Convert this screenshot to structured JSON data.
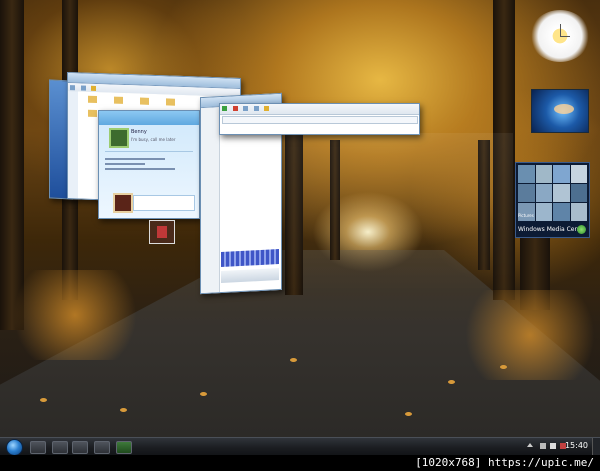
{
  "taskbar": {
    "clock": "15:40"
  },
  "gadgets": {
    "media_center_label": "Windows Media Center",
    "media_center_tile_label": "Pictures"
  },
  "windows": {
    "messenger": {
      "contact_name": "Benny",
      "status_line": "I'm busy, call me later"
    }
  },
  "watermark": {
    "text": "[1020x768] https://upic.me/"
  },
  "colors": {
    "taskbar": "#1b1d21",
    "window_frame": "#6b8fb3",
    "messenger_header": "#5fa8e0",
    "media_player_visualizer": "#3f56c7"
  }
}
